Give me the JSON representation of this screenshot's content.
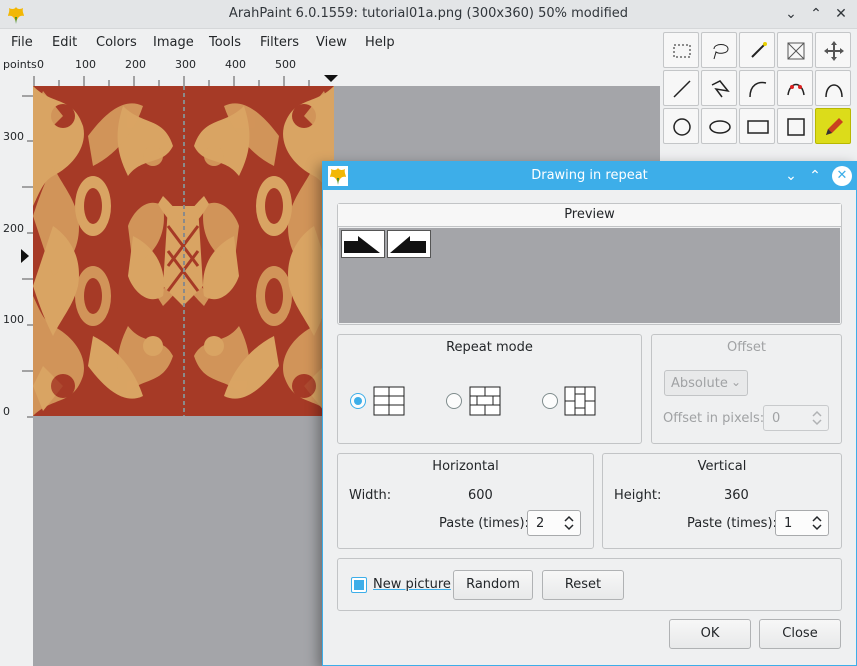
{
  "app": {
    "title": "ArahPaint 6.0.1559: tutorial01a.png (300x360) 50% modified"
  },
  "menu": [
    "File",
    "Edit",
    "Colors",
    "Image",
    "Tools",
    "Filters",
    "View",
    "Help"
  ],
  "ruler": {
    "units": "points",
    "h_labels": [
      "0",
      "100",
      "200",
      "300",
      "400",
      "500"
    ],
    "v_labels": [
      "300",
      "200",
      "100",
      "0"
    ]
  },
  "tools": [
    {
      "name": "rect-select-icon"
    },
    {
      "name": "lasso-select-icon"
    },
    {
      "name": "magic-wand-icon"
    },
    {
      "name": "crop-icon"
    },
    {
      "name": "move-icon"
    },
    {
      "name": "line-icon"
    },
    {
      "name": "polyline-icon"
    },
    {
      "name": "arc-icon"
    },
    {
      "name": "bezier-icon"
    },
    {
      "name": "curve-icon"
    },
    {
      "name": "circle-icon"
    },
    {
      "name": "ellipse-icon"
    },
    {
      "name": "rectangle-icon"
    },
    {
      "name": "square-icon"
    },
    {
      "name": "pencil-icon",
      "active": true
    }
  ],
  "dialog": {
    "title": "Drawing in repeat",
    "preview": {
      "title": "Preview"
    },
    "repeat_mode": {
      "title": "Repeat mode",
      "selected": "grid"
    },
    "offset": {
      "title": "Offset",
      "mode": "Absolute",
      "pixels_label": "Offset in pixels:",
      "pixels_value": "0"
    },
    "horizontal": {
      "title": "Horizontal",
      "width_label": "Width:",
      "width_value": "600",
      "paste_label": "Paste (times):",
      "paste_value": "2"
    },
    "vertical": {
      "title": "Vertical",
      "height_label": "Height:",
      "height_value": "360",
      "paste_label": "Paste (times):",
      "paste_value": "1"
    },
    "new_picture_label": "New picture",
    "random_label": "Random",
    "reset_label": "Reset",
    "ok_label": "OK",
    "close_label": "Close"
  },
  "colors": {
    "accent": "#3daee9",
    "artwork_red": "#a63a26",
    "artwork_tan": "#d9a463",
    "canvas_bg": "#a4a5a9",
    "active_tool": "#dcdc1a"
  }
}
